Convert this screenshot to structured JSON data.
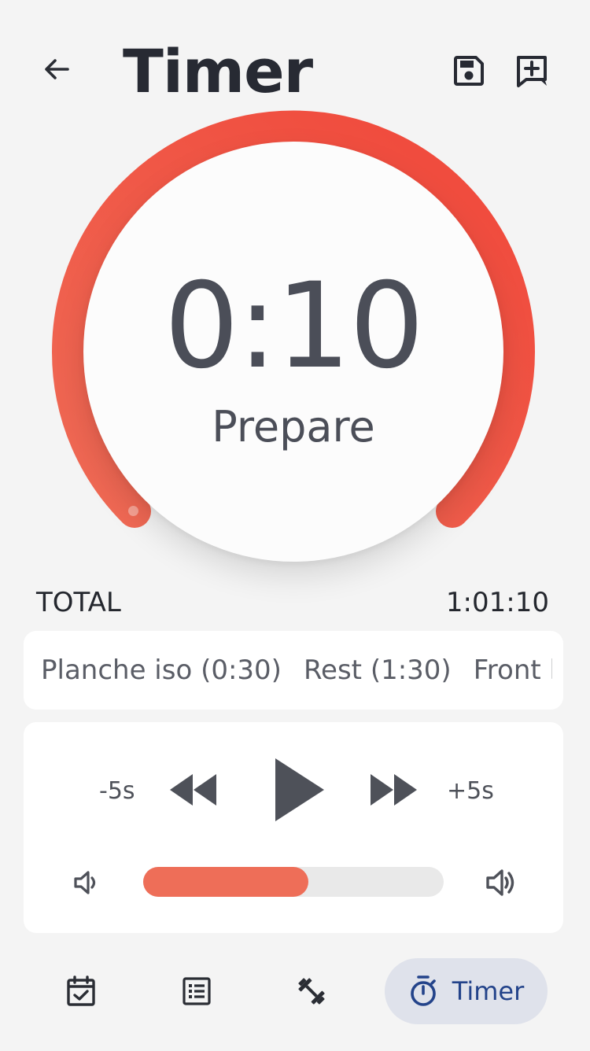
{
  "header": {
    "title": "Timer",
    "back_icon": "arrow-left-icon",
    "save_icon": "save-icon",
    "add_note_icon": "add-comment-icon"
  },
  "timer": {
    "time": "0:10",
    "phase": "Prepare",
    "progress_fraction": 1.0,
    "ring_color_start": "#ef6a55",
    "ring_color_end": "#f0473a"
  },
  "total": {
    "label": "TOTAL",
    "value": "1:01:10"
  },
  "sequence": {
    "items": [
      {
        "label": "Planche iso (0:30)"
      },
      {
        "label": "Rest (1:30)"
      },
      {
        "label": "Front le"
      }
    ]
  },
  "controls": {
    "minus_label": "-5s",
    "plus_label": "+5s",
    "rewind_icon": "rewind-icon",
    "play_icon": "play-icon",
    "fast_forward_icon": "fast-forward-icon",
    "volume_low_icon": "volume-low-icon",
    "volume_high_icon": "volume-high-icon",
    "volume_level": 0.55
  },
  "nav": {
    "items": [
      {
        "icon": "calendar-check-icon"
      },
      {
        "icon": "list-icon"
      },
      {
        "icon": "dumbbell-icon"
      },
      {
        "icon": "stopwatch-icon",
        "label": "Timer",
        "active": true
      }
    ]
  },
  "colors": {
    "accent": "#ee6e58",
    "nav_active_bg": "#dfe2eb",
    "nav_active_fg": "#23438a"
  }
}
